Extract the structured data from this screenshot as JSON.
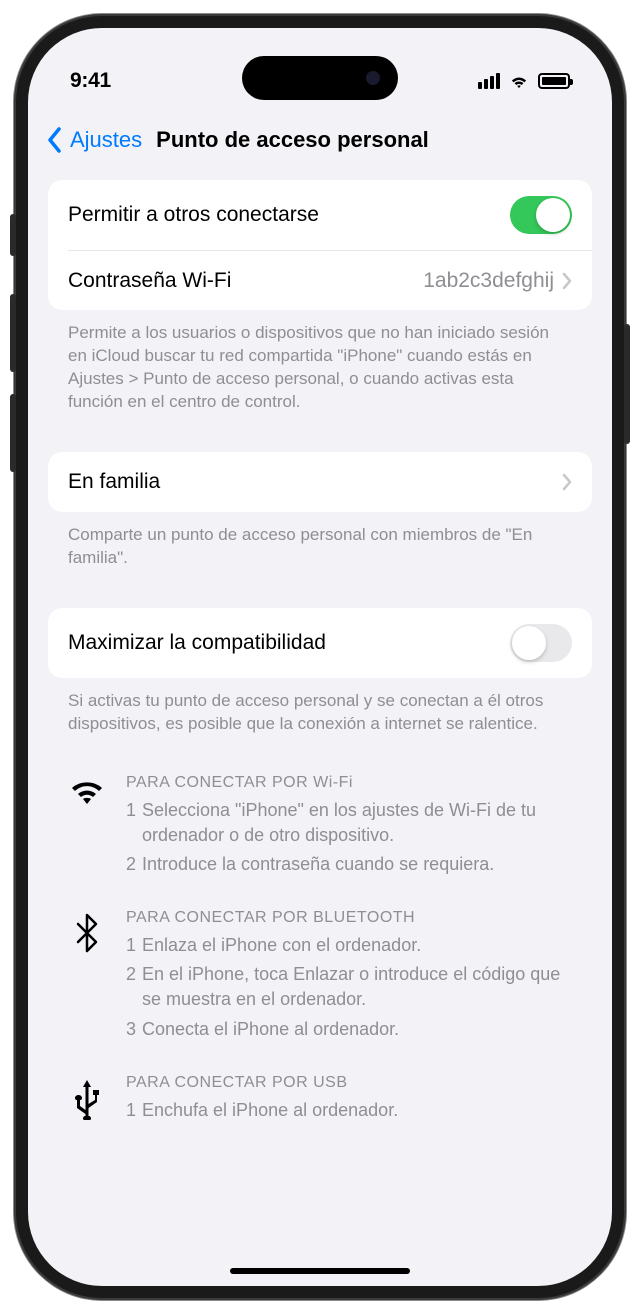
{
  "status": {
    "time": "9:41"
  },
  "nav": {
    "back": "Ajustes",
    "title": "Punto de acceso personal"
  },
  "allow_others": {
    "label": "Permitir a otros conectarse",
    "enabled": true
  },
  "wifi_password": {
    "label": "Contraseña Wi-Fi",
    "value": "1ab2c3defghij"
  },
  "allow_footer": "Permite a los usuarios o dispositivos que no han iniciado sesión en iCloud buscar tu red compartida \"iPhone\" cuando estás en Ajustes > Punto de acceso personal, o cuando activas esta función en el centro de control.",
  "family": {
    "label": "En familia",
    "footer": "Comparte un punto de acceso personal con miembros de \"En familia\"."
  },
  "compat": {
    "label": "Maximizar la compatibilidad",
    "enabled": false,
    "footer": "Si activas tu punto de acceso personal y se conectan a él otros dispositivos, es posible que la conexión a internet se ralentice."
  },
  "instructions": {
    "wifi": {
      "title": "PARA CONECTAR POR Wi-Fi",
      "steps": [
        "Selecciona \"iPhone\" en los ajustes de Wi-Fi de tu ordenador o de otro dispositivo.",
        "Introduce la contraseña cuando se requiera."
      ]
    },
    "bluetooth": {
      "title": "PARA CONECTAR POR BLUETOOTH",
      "steps": [
        "Enlaza el iPhone con el ordenador.",
        "En el iPhone, toca Enlazar o introduce el código que se muestra en el ordenador.",
        "Conecta el iPhone al ordenador."
      ]
    },
    "usb": {
      "title": "PARA CONECTAR POR USB",
      "steps": [
        "Enchufa el iPhone al ordenador."
      ]
    }
  }
}
